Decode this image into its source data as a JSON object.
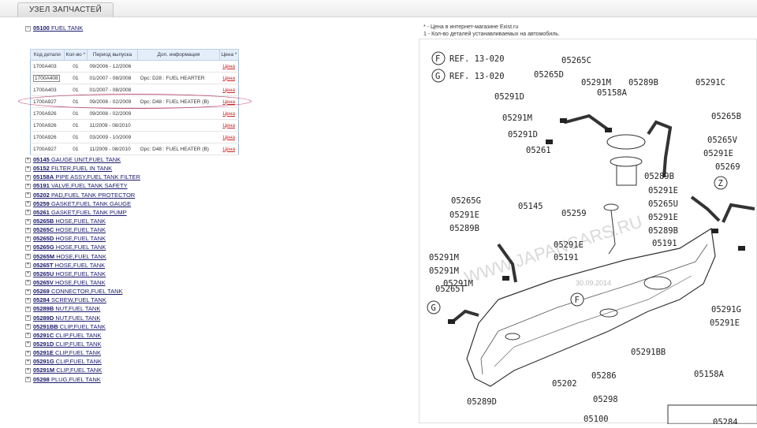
{
  "tab": {
    "label": "УЗЕЛ ЗАПЧАСТЕЙ"
  },
  "root": {
    "toggle": "⊟",
    "code": "05100",
    "name": "FUEL TANK"
  },
  "table": {
    "headers": [
      "Код детали",
      "Кол-во *",
      "Период выпуска",
      "Доп. информация",
      "Цена *"
    ],
    "rows": [
      [
        "1700A403",
        "01",
        "09/2006 - 12/2006",
        "",
        "Цена"
      ],
      [
        "1700A408",
        "01",
        "01/2007 - 08/2008",
        "Opc: D28 : FUEL HEARTER",
        "Цена"
      ],
      [
        "1700A403",
        "01",
        "01/2007 - 08/2008",
        "",
        "Цена"
      ],
      [
        "1700A927",
        "01",
        "09/2008 - 02/2009",
        "Opc: D48 : FUEL HEATER (B)",
        "Цена"
      ],
      [
        "1700A926",
        "01",
        "09/2008 - 02/2009",
        "",
        "Цена"
      ],
      [
        "1700A926",
        "01",
        "11/2009 - 08/2010",
        "",
        "Цена"
      ],
      [
        "1700A926",
        "01",
        "03/2009 - 10/2009",
        "",
        "Цена"
      ],
      [
        "1700A927",
        "01",
        "11/2009 - 08/2010",
        "Opc: D48 : FUEL HEATER (B)",
        "Цена"
      ]
    ]
  },
  "items": [
    {
      "code": "05145",
      "name": "GAUGE UNIT,FUEL TANK"
    },
    {
      "code": "05152",
      "name": "FILTER,FUEL IN TANK"
    },
    {
      "code": "05158A",
      "name": "PIPE ASSY,FUEL TANK FILTER"
    },
    {
      "code": "05191",
      "name": "VALVE,FUEL TANK SAFETY"
    },
    {
      "code": "05202",
      "name": "PAD,FUEL TANK PROTECTOR"
    },
    {
      "code": "05259",
      "name": "GASKET,FUEL TANK GAUGE"
    },
    {
      "code": "05261",
      "name": "GASKET,FUEL TANK PUMP"
    },
    {
      "code": "05265B",
      "name": "HOSE,FUEL TANK"
    },
    {
      "code": "05265C",
      "name": "HOSE,FUEL TANK"
    },
    {
      "code": "05265D",
      "name": "HOSE,FUEL TANK"
    },
    {
      "code": "05265G",
      "name": "HOSE,FUEL TANK"
    },
    {
      "code": "05265M",
      "name": "HOSE,FUEL TANK"
    },
    {
      "code": "05265T",
      "name": "HOSE,FUEL TANK"
    },
    {
      "code": "05265U",
      "name": "HOSE,FUEL TANK"
    },
    {
      "code": "05265V",
      "name": "HOSE,FUEL TANK"
    },
    {
      "code": "05269",
      "name": "CONNECTOR,FUEL TANK"
    },
    {
      "code": "05284",
      "name": "SCREW,FUEL TANK"
    },
    {
      "code": "05289B",
      "name": "NUT,FUEL TANK"
    },
    {
      "code": "05289D",
      "name": "NUT,FUEL TANK"
    },
    {
      "code": "05291BB",
      "name": "CLIP,FUEL TANK"
    },
    {
      "code": "05291C",
      "name": "CLIP,FUEL TANK"
    },
    {
      "code": "05291D",
      "name": "CLIP,FUEL TANK"
    },
    {
      "code": "05291E",
      "name": "CLIP,FUEL TANK"
    },
    {
      "code": "05291G",
      "name": "CLIP,FUEL TANK"
    },
    {
      "code": "05291M",
      "name": "CLIP,FUEL TANK"
    },
    {
      "code": "05298",
      "name": "PLUG,FUEL TANK"
    }
  ],
  "notes": {
    "line1": "* - Цена в интернет-магазине Exist.ru",
    "line2": "1 - Кол-во деталей устанавливаемых на автомобиль."
  },
  "diagram": {
    "refs": [
      {
        "circle": "F",
        "ref": "REF.",
        "num": "13-020"
      },
      {
        "circle": "G",
        "ref": "REF.",
        "num": "13-020"
      }
    ],
    "labels": [
      "05265C",
      "05265D",
      "05291M",
      "05289B",
      "05291C",
      "05158A",
      "05291D",
      "05291M",
      "05265B",
      "05291D",
      "05261",
      "05265V",
      "05291E",
      "05269",
      "05289B",
      "05291E",
      "05265U",
      "05291E",
      "05265G",
      "05145",
      "05259",
      "05289B",
      "05291E",
      "05191",
      "05289B",
      "05291M",
      "05291E",
      "05191",
      "05291M",
      "05265T",
      "05291M",
      "05291G",
      "05291E",
      "05291BB",
      "05286",
      "05202",
      "05298",
      "05289D",
      "05100",
      "05158A",
      "05284"
    ],
    "circles": [
      "Z",
      "G",
      "F"
    ],
    "watermark": "WWW.JAPANCARS.RU",
    "date": "30.09.2014"
  }
}
